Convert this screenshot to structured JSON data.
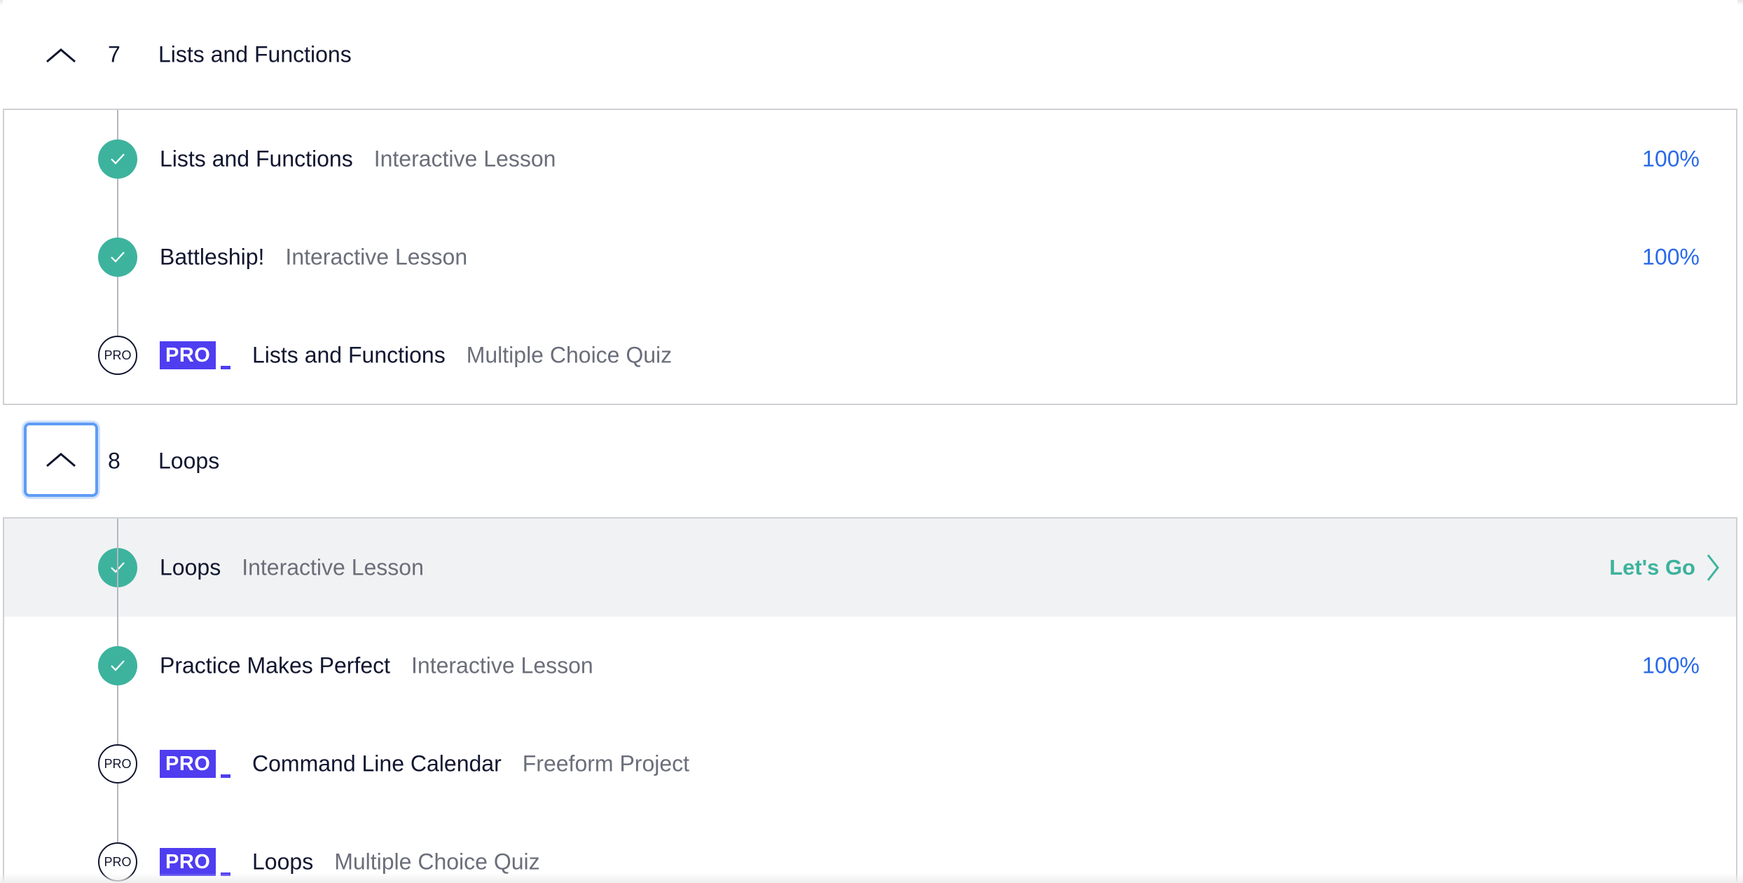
{
  "modules": [
    {
      "number": "7",
      "title": "Lists and Functions",
      "items": [
        {
          "status": "complete",
          "pro": false,
          "title": "Lists and Functions",
          "type": "Interactive Lesson",
          "progress": "100%"
        },
        {
          "status": "complete",
          "pro": false,
          "title": "Battleship!",
          "type": "Interactive Lesson",
          "progress": "100%"
        },
        {
          "status": "locked",
          "pro": true,
          "status_label": "PRO",
          "badge": "PRO",
          "title": "Lists and Functions",
          "type": "Multiple Choice Quiz",
          "progress": ""
        }
      ]
    },
    {
      "number": "8",
      "title": "Loops",
      "items": [
        {
          "status": "complete",
          "pro": false,
          "title": "Loops",
          "type": "Interactive Lesson",
          "cta": "Let's Go"
        },
        {
          "status": "complete",
          "pro": false,
          "title": "Practice Makes Perfect",
          "type": "Interactive Lesson",
          "progress": "100%"
        },
        {
          "status": "locked",
          "pro": true,
          "status_label": "PRO",
          "badge": "PRO",
          "title": "Command Line Calendar",
          "type": "Freeform Project",
          "progress": ""
        },
        {
          "status": "locked",
          "pro": true,
          "status_label": "PRO",
          "badge": "PRO",
          "title": "Loops",
          "type": "Multiple Choice Quiz",
          "progress": ""
        }
      ]
    }
  ],
  "colors": {
    "complete": "#3db39e",
    "progress": "#2a6ae8",
    "pro_badge": "#4f3df0",
    "focus_ring": "#5e9cf5",
    "active_row": "#f1f2f3"
  },
  "icons": {
    "toggle": "chevron-up-icon",
    "complete": "checkmark-icon",
    "cta": "chevron-right-icon"
  }
}
